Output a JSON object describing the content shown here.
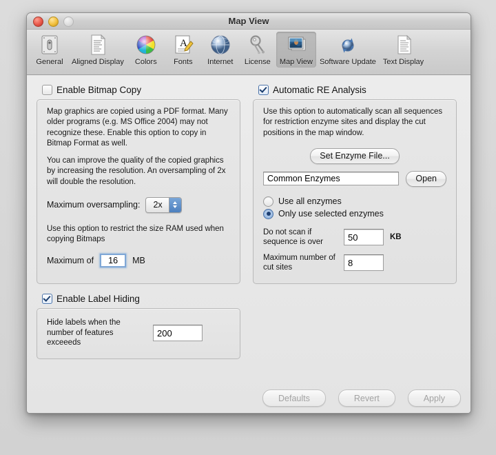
{
  "window": {
    "title": "Map View",
    "lights": {
      "close": "close-button",
      "minimize": "minimize-button",
      "zoom": "zoom-button"
    }
  },
  "toolbar": {
    "items": [
      {
        "label": "General",
        "icon": "general-icon",
        "selected": false
      },
      {
        "label": "Aligned Display",
        "icon": "aligned-display-icon",
        "selected": false
      },
      {
        "label": "Colors",
        "icon": "colors-icon",
        "selected": false
      },
      {
        "label": "Fonts",
        "icon": "fonts-icon",
        "selected": false
      },
      {
        "label": "Internet",
        "icon": "internet-icon",
        "selected": false
      },
      {
        "label": "License",
        "icon": "license-icon",
        "selected": false
      },
      {
        "label": "Map View",
        "icon": "map-view-icon",
        "selected": true
      },
      {
        "label": "Software Update",
        "icon": "software-update-icon",
        "selected": false
      },
      {
        "label": "Text Display",
        "icon": "text-display-icon",
        "selected": false
      }
    ]
  },
  "bitmap": {
    "checkbox_label": "Enable Bitmap Copy",
    "checked": false,
    "paragraph_1": "Map graphics are copied using a PDF format. Many older programs (e.g. MS Office 2004) may not recognize these. Enable this option to copy in Bitmap Format as well.",
    "paragraph_2": "You can improve the quality of the copied graphics by increasing the resolution. An oversampling of 2x will double the resolution.",
    "oversampling_label": "Maximum oversampling:",
    "oversampling_value": "2x",
    "paragraph_3": "Use this option to restrict the size RAM used when copying Bitmaps",
    "maximum_of_label": "Maximum of",
    "maximum_of_value": "16",
    "maximum_of_unit": "MB"
  },
  "label_hiding": {
    "checkbox_label": "Enable Label Hiding",
    "checked": true,
    "description": "Hide labels when the number of features exceeeds",
    "value": "200"
  },
  "re_analysis": {
    "checkbox_label": "Automatic RE Analysis",
    "checked": true,
    "paragraph_1": "Use this option to automatically scan all sequences for restriction enzyme sites and display the cut positions in the map window.",
    "set_enzyme_file_button": "Set Enzyme File...",
    "enzyme_file_value": "Common Enzymes",
    "open_button": "Open",
    "radio_all_label": "Use all enzymes",
    "radio_selected_label": "Only use selected enzymes",
    "radio_selected": "only_selected",
    "do_not_scan_label": "Do not scan if sequence is over",
    "do_not_scan_value": "50",
    "do_not_scan_unit": "KB",
    "max_cut_sites_label": "Maximum number of cut sites",
    "max_cut_sites_value": "8"
  },
  "footer": {
    "defaults": "Defaults",
    "revert": "Revert",
    "apply": "Apply"
  },
  "colors": {
    "accent": "#4c7fbe",
    "window_bg": "#ededed",
    "box_bg": "#e5e5e5",
    "focus_ring": "#7fa7d6"
  }
}
